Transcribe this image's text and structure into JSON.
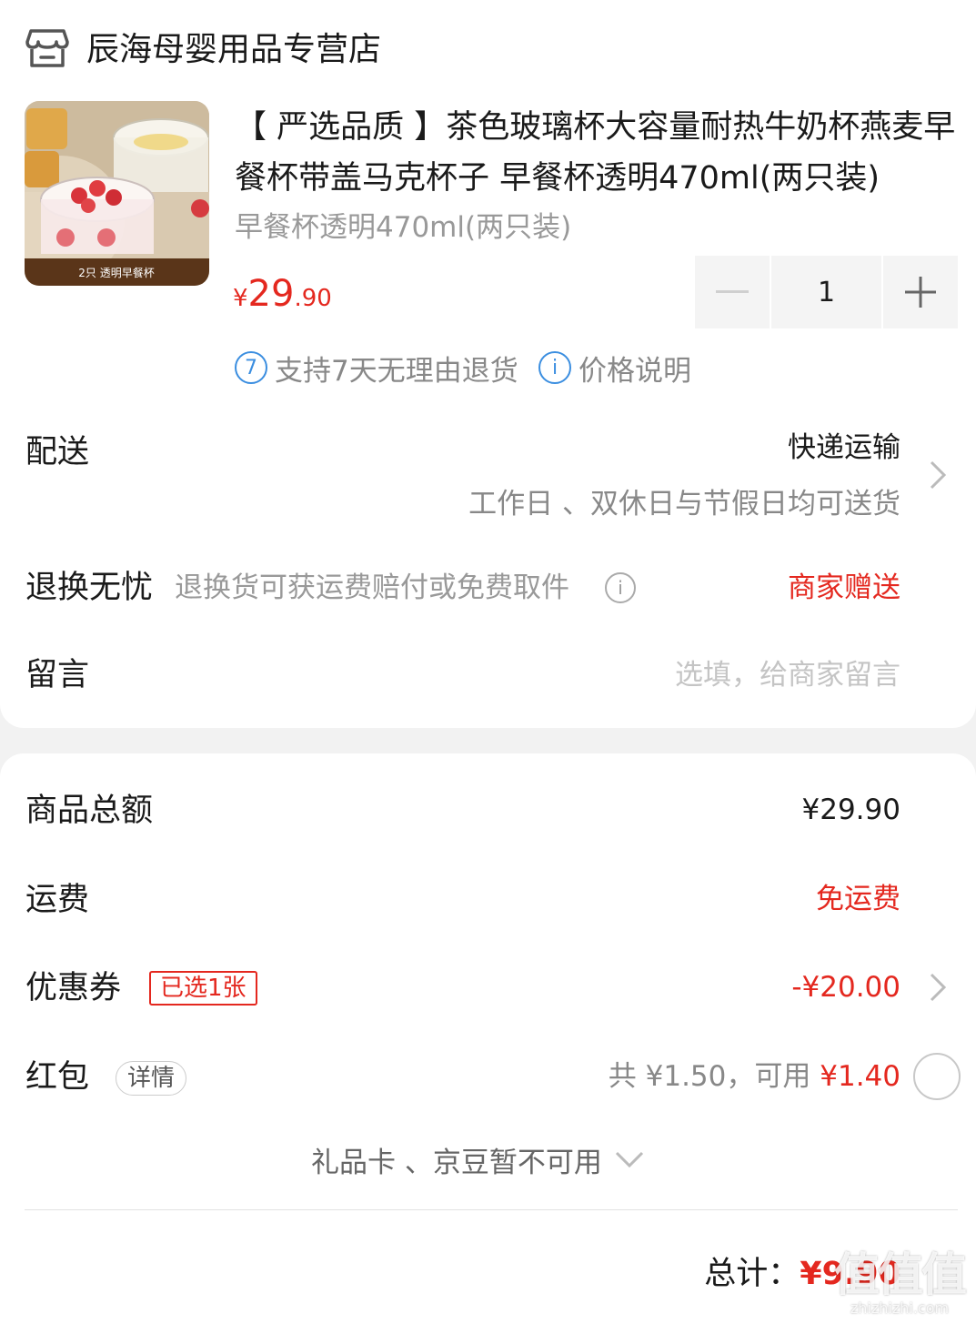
{
  "shop": {
    "icon": "store-icon",
    "name": "辰海母婴用品专营店"
  },
  "product": {
    "image_caption": "2只 透明早餐杯",
    "title": "【 严选品质 】茶色玻璃杯大容量耐热牛奶杯燕麦早餐杯带盖马克杯子 早餐杯透明470ml(两只装)",
    "spec": "早餐杯透明470ml(两只装)",
    "price_currency": "¥",
    "price_int": "29",
    "price_dec": ".90",
    "quantity": "1",
    "minus_label": "−",
    "plus_label": "+",
    "return_badge": "7",
    "return_policy": "支持7天无理由退货",
    "price_info_badge": "i",
    "price_info": "价格说明"
  },
  "delivery": {
    "label": "配送",
    "method": "快递运输",
    "note": "工作日 、双休日与节假日均可送货"
  },
  "returns": {
    "label": "退换无忧",
    "desc": "退换货可获运费赔付或免费取件",
    "info_badge": "i",
    "value": "商家赠送"
  },
  "message": {
    "label": "留言",
    "placeholder": "选填，给商家留言"
  },
  "summary": {
    "goods_total_label": "商品总额",
    "goods_total_value": "¥29.90",
    "shipping_label": "运费",
    "shipping_value": "免运费",
    "coupon_label": "优惠券",
    "coupon_tag": "已选1张",
    "coupon_value": "-¥20.00",
    "redpacket_label": "红包",
    "redpacket_tag": "详情",
    "redpacket_total_prefix": "共 ¥1.50，可用 ",
    "redpacket_available": "¥1.40",
    "giftcard_note": "礼品卡 、京豆暂不可用",
    "grand_total_label": "总计：",
    "grand_total_value": "¥9.90"
  },
  "watermark": {
    "main": "值值值",
    "sub": "zhizhizhi.com"
  },
  "colors": {
    "accent_red": "#e4281f",
    "link_blue": "#3b8ee0",
    "muted_grey": "#999999"
  }
}
